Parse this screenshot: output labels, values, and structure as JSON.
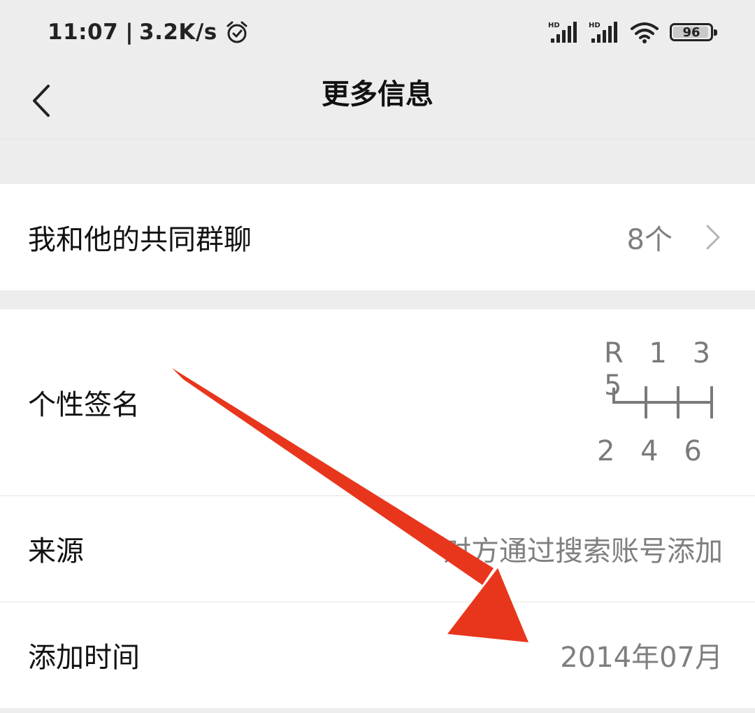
{
  "status_bar": {
    "time": "11:07",
    "separator": "|",
    "net_speed": "3.2K/s",
    "battery_level": "96",
    "battery_percent": 96,
    "icons": [
      "alarm-icon",
      "signal-hd-icon",
      "signal-hd-icon",
      "wifi-icon",
      "battery-icon"
    ]
  },
  "nav": {
    "title": "更多信息",
    "back_icon": "chevron-left-icon"
  },
  "groups_section": {
    "label": "我和他的共同群聊",
    "value": "8个",
    "chevron_icon": "chevron-right-icon"
  },
  "info_section": {
    "signature": {
      "label": "个性签名",
      "top_line": "R 1 3 5",
      "bottom_line": "2 4 6",
      "drawing_icon": "gear-shift-pattern-icon"
    },
    "source": {
      "label": "来源",
      "value": "对方通过搜索账号添加"
    },
    "added_time": {
      "label": "添加时间",
      "value": "2014年07月"
    }
  },
  "annotation": {
    "arrow_icon": "red-arrow-icon",
    "color": "#e8361c"
  },
  "colors": {
    "background": "#ededed",
    "card": "#ffffff",
    "secondary_text": "#7f7f7f"
  }
}
